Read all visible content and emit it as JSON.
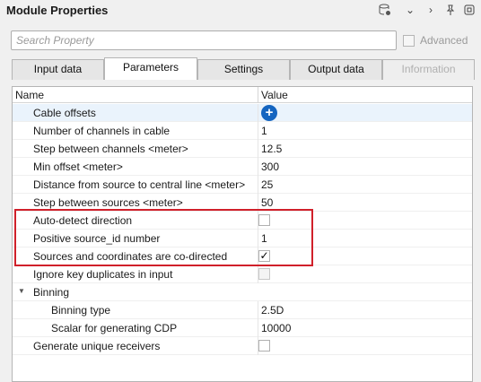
{
  "header": {
    "title": "Module Properties",
    "icons": [
      "database-gear-icon",
      "chevron-down-icon",
      "chevron-right-icon",
      "pin-icon",
      "restore-window-icon"
    ]
  },
  "search": {
    "placeholder": "Search Property"
  },
  "advanced": {
    "label": "Advanced",
    "checked": false
  },
  "tabs": [
    {
      "label": "Input data"
    },
    {
      "label": "Parameters",
      "active": true
    },
    {
      "label": "Settings"
    },
    {
      "label": "Output data"
    },
    {
      "label": "Information",
      "disabled": true
    }
  ],
  "grid": {
    "col_name": "Name",
    "col_value": "Value",
    "rows": [
      {
        "name": "Cable offsets",
        "value": ""
      },
      {
        "name": "Number of channels in cable",
        "value": "1"
      },
      {
        "name": "Step between channels <meter>",
        "value": "12.5"
      },
      {
        "name": "Min offset <meter>",
        "value": "300"
      },
      {
        "name": "Distance from source to central line <meter>",
        "value": "25"
      },
      {
        "name": "Step between sources <meter>",
        "value": "50"
      },
      {
        "name": "Auto-detect direction",
        "value": ""
      },
      {
        "name": "Positive source_id number",
        "value": "1"
      },
      {
        "name": "Sources and coordinates are co-directed",
        "value": "✓"
      },
      {
        "name": "Ignore key duplicates in input",
        "value": ""
      },
      {
        "name": "Binning",
        "value": ""
      },
      {
        "name": "Binning type",
        "value": "2.5D"
      },
      {
        "name": "Scalar for generating CDP",
        "value": "10000"
      },
      {
        "name": "Generate unique receivers",
        "value": ""
      }
    ]
  },
  "colors": {
    "highlight_box": "#d0202a",
    "add_button": "#1565c0",
    "selected_row": "#eaf3fc"
  }
}
